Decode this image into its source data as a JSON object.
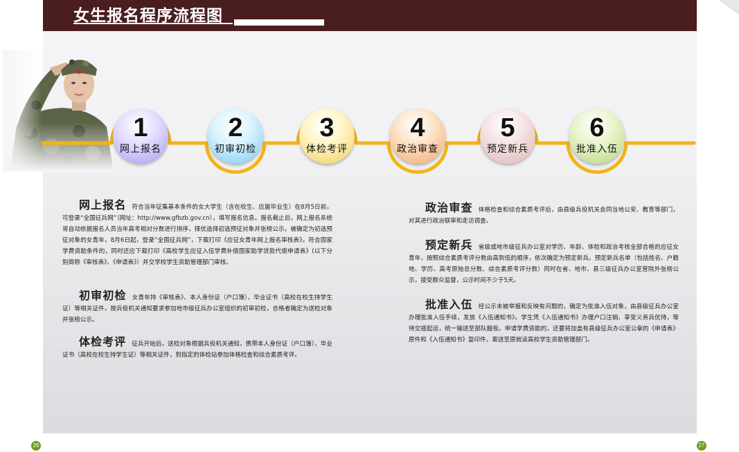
{
  "header": {
    "title": "女生报名程序流程图"
  },
  "steps": [
    {
      "num": "1",
      "label": "网上报名"
    },
    {
      "num": "2",
      "label": "初审初检"
    },
    {
      "num": "3",
      "label": "体检考评"
    },
    {
      "num": "4",
      "label": "政治审查"
    },
    {
      "num": "5",
      "label": "预定新兵"
    },
    {
      "num": "6",
      "label": "批准入伍"
    }
  ],
  "sections": [
    {
      "heading": "网上报名",
      "text": "符合当年征集基本条件的女大学生（含在校生、应届毕业生）在8月5日前，可登录“全国征兵网”（网址：http://www.gfbzb.gov.cn），填写报名信息。报名截止后，网上报名系统将自动依据报名人员当年高考相对分数进行排序，择优选择初选预征对象并张榜公示。被确定为初选预征对象的女青年，8月6日起，登录“全国征兵网”，下载打印《应征女青年网上报名审核表》。符合国家学费资助条件的，同时还应下载打印《高校学生应征入伍学费补偿国家助学贷款代偿申请表》(以下分别简称《审核表》、《申请表》）并交学校学生资助管理部门审核。"
    },
    {
      "heading": "初审初检",
      "text": "女青年持《审核表》、本人身份证（户口簿）、毕业证书（高校在校生持学生证）等相关证件，按兵役机关通知要求参加地市级征兵办公室组织的初审初检，合格者确定为送检对象并张榜公示。"
    },
    {
      "heading": "体检考评",
      "text": "征兵开始后，送检对象根据兵役机关通知，携带本人身份证（户口簿）、毕业证书（高校在校生持学生证）等相关证件，到指定的体检站参加体格检查和综合素质考评。"
    },
    {
      "heading": "政治审查",
      "text": "体格检查和综合素质考评后，由县级兵役机关会同当地公安、教育等部门，对其进行政治联审和走访调查。"
    },
    {
      "heading": "预定新兵",
      "text": "省级或地市级征兵办公室对学历、年龄、体检和政治考核全部合格的应征女青年，按照综合素质考评分数由高到低的顺序，依次确定为预定新兵。预定新兵名单（包括姓名、户籍地、学历、高考原始总分数、综合素质考评分数）同时在省、地市、县三级征兵办公室营院外张榜公示，接受群众监督，公示时间不少于5天。"
    },
    {
      "heading": "批准入伍",
      "text": "经公示未被举报和反映有问题的，确定为批准入伍对象，由县级征兵办公室办理批准入伍手续，发放《入伍通知书》。学生凭《入伍通知书》办理户口注销、享受义务兵优待，等待交接起运，统一输送至部队服役。申请学费资助的，还要将加盖有县级征兵办公室公章的《申请表》原件和《入伍通知书》复印件，寄送至原就读高校学生资助管理部门。"
    }
  ],
  "page_numbers": {
    "left": "26",
    "right": "27"
  },
  "colors": {
    "header_bg": "#4a1d1f",
    "timeline": "#f3b418",
    "page_badge": "#6f9a24"
  }
}
